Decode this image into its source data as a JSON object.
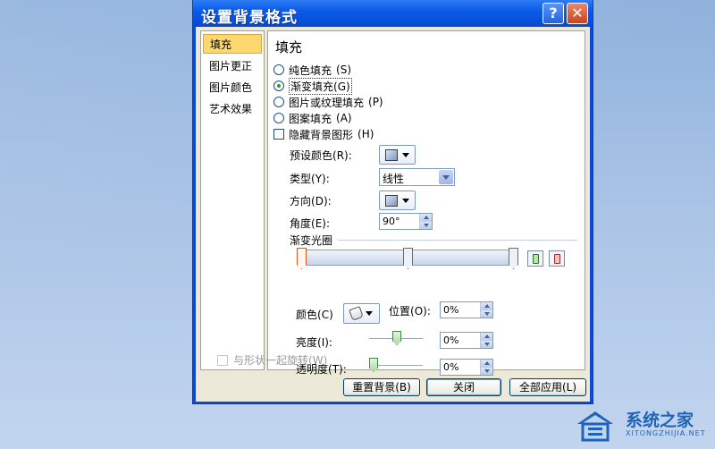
{
  "dialog": {
    "title": "设置背景格式",
    "help_symbol": "?",
    "close_symbol": "✕"
  },
  "nav": {
    "items": [
      {
        "label": "填充"
      },
      {
        "label": "图片更正"
      },
      {
        "label": "图片颜色"
      },
      {
        "label": "艺术效果"
      }
    ]
  },
  "panel": {
    "section_title": "填充",
    "options": [
      {
        "label": "纯色填充",
        "key": "(S)"
      },
      {
        "label": "渐变填充",
        "key": "(G)"
      },
      {
        "label": "图片或纹理填充",
        "key": "(P)"
      },
      {
        "label": "图案填充",
        "key": "(A)"
      }
    ],
    "hide_bg": {
      "label": "隐藏背景图形",
      "key": "(H)"
    },
    "preset": {
      "label": "预设颜色",
      "key": "(R):"
    },
    "type": {
      "label": "类型",
      "key": "(Y):",
      "value": "线性"
    },
    "direction": {
      "label": "方向",
      "key": "(D):"
    },
    "angle": {
      "label": "角度",
      "key": "(E):",
      "value": "90°"
    },
    "stops_title": "渐变光圈",
    "color": {
      "label": "颜色",
      "key": "(C)"
    },
    "position": {
      "label": "位置",
      "key": "(O):",
      "value": "0%"
    },
    "brightness": {
      "label": "亮度",
      "key": "(I):",
      "value": "0%"
    },
    "transparency": {
      "label": "透明度",
      "key": "(T):",
      "value": "0%"
    },
    "rotate": {
      "label": "与形状一起旋转",
      "key": "(W)"
    }
  },
  "buttons": {
    "reset": "重置背景(B)",
    "close": "关闭",
    "apply_all": "全部应用(L)"
  },
  "watermark": {
    "text": "系统之家",
    "sub": "XITONGZHIJIA.NET"
  }
}
